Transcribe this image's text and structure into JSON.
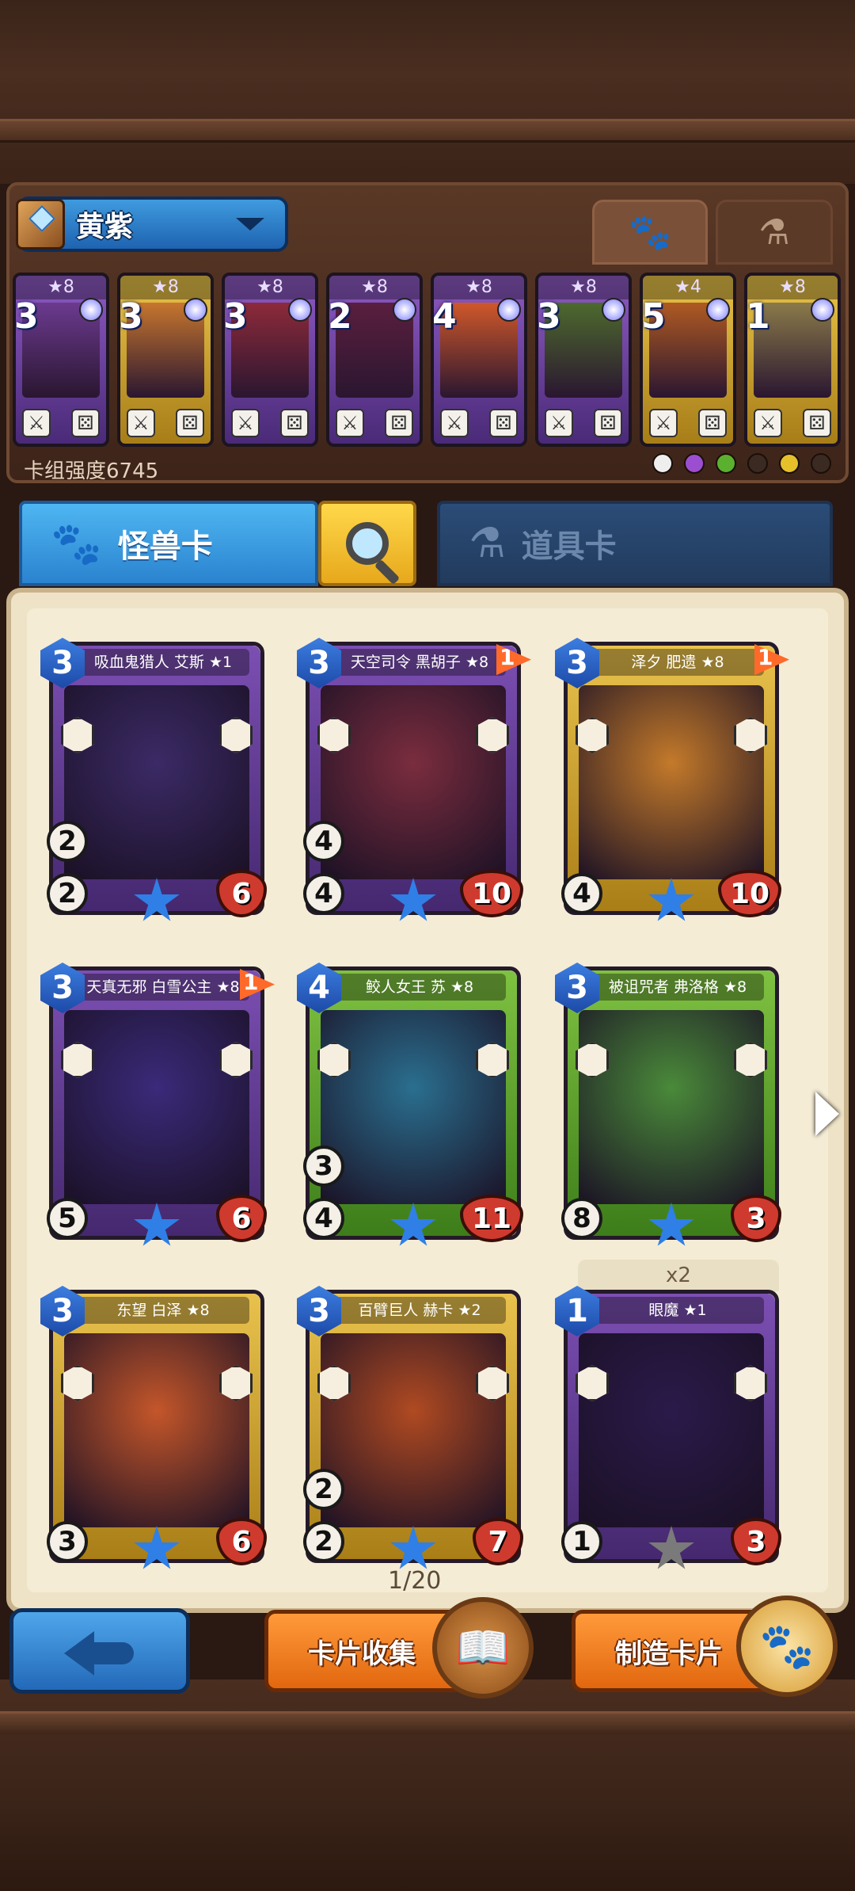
{
  "deck": {
    "name": "黄紫",
    "power_label": "卡组强度6745",
    "tabs": {
      "monsters_icon": "paw-icon",
      "items_icon": "flask-icon"
    },
    "cards": [
      {
        "stars": "★8",
        "cost": "3",
        "color": "purple",
        "art": "#6b3a8f"
      },
      {
        "stars": "★8",
        "cost": "3",
        "color": "gold",
        "art": "#c7762e"
      },
      {
        "stars": "★8",
        "cost": "3",
        "color": "purple",
        "art": "#8d2a3a"
      },
      {
        "stars": "★8",
        "cost": "2",
        "color": "purple",
        "art": "#5a1f3f"
      },
      {
        "stars": "★8",
        "cost": "4",
        "color": "purple",
        "art": "#d0582a"
      },
      {
        "stars": "★8",
        "cost": "3",
        "color": "purple",
        "art": "#4d6a2e"
      },
      {
        "stars": "★4",
        "cost": "5",
        "color": "gold",
        "art": "#b05a22"
      },
      {
        "stars": "★8",
        "cost": "1",
        "color": "gold",
        "art": "#8a7a4a"
      }
    ]
  },
  "category_tabs": {
    "monster_label": "怪兽卡",
    "item_label": "道具卡"
  },
  "collection": {
    "cards": [
      {
        "cost": "3",
        "name": "吸血鬼猎人 艾斯 ★1",
        "atk": "2",
        "spd": "2",
        "hp": "6",
        "color": "purple",
        "flag": "",
        "art": "#3b2a66"
      },
      {
        "cost": "3",
        "name": "天空司令 黑胡子 ★8",
        "atk": "4",
        "spd": "4",
        "hp": "10",
        "color": "purple",
        "flag": "1",
        "art": "#7a2d3e"
      },
      {
        "cost": "3",
        "name": "泽夕 肥遗 ★8",
        "atk": "",
        "spd": "4",
        "hp": "10",
        "color": "gold",
        "flag": "1",
        "art": "#c47a2a"
      },
      {
        "cost": "3",
        "name": "天真无邪 白雪公主 ★8",
        "atk": "",
        "spd": "5",
        "hp": "6",
        "color": "purple",
        "flag": "1",
        "art": "#3a2a7a"
      },
      {
        "cost": "4",
        "name": "鲛人女王 苏 ★8",
        "atk": "3",
        "spd": "4",
        "hp": "11",
        "color": "green",
        "flag": "",
        "art": "#2a6f8f"
      },
      {
        "cost": "3",
        "name": "被诅咒者 弗洛格 ★8",
        "atk": "",
        "spd": "8",
        "hp": "3",
        "color": "green",
        "flag": "",
        "art": "#4a8a3a"
      },
      {
        "cost": "3",
        "name": "东望 白泽 ★8",
        "atk": "",
        "spd": "3",
        "hp": "6",
        "color": "gold",
        "flag": "",
        "art": "#c4562a"
      },
      {
        "cost": "3",
        "name": "百臂巨人 赫卡 ★2",
        "atk": "2",
        "spd": "2",
        "hp": "7",
        "color": "gold",
        "flag": "",
        "art": "#b04a22"
      },
      {
        "cost": "1",
        "name": "眼魔 ★1",
        "atk": "",
        "spd": "1",
        "hp": "3",
        "color": "purple",
        "flag": "",
        "art": "#2a1a4a"
      }
    ],
    "duplicate_label": "x2",
    "page_indicator": "1/20"
  },
  "buttons": {
    "collect_label": "卡片收集",
    "craft_label": "制造卡片"
  },
  "colors": {
    "accent_blue": "#2a83cf",
    "accent_orange": "#e2670f",
    "parchment": "#efe3c7"
  }
}
